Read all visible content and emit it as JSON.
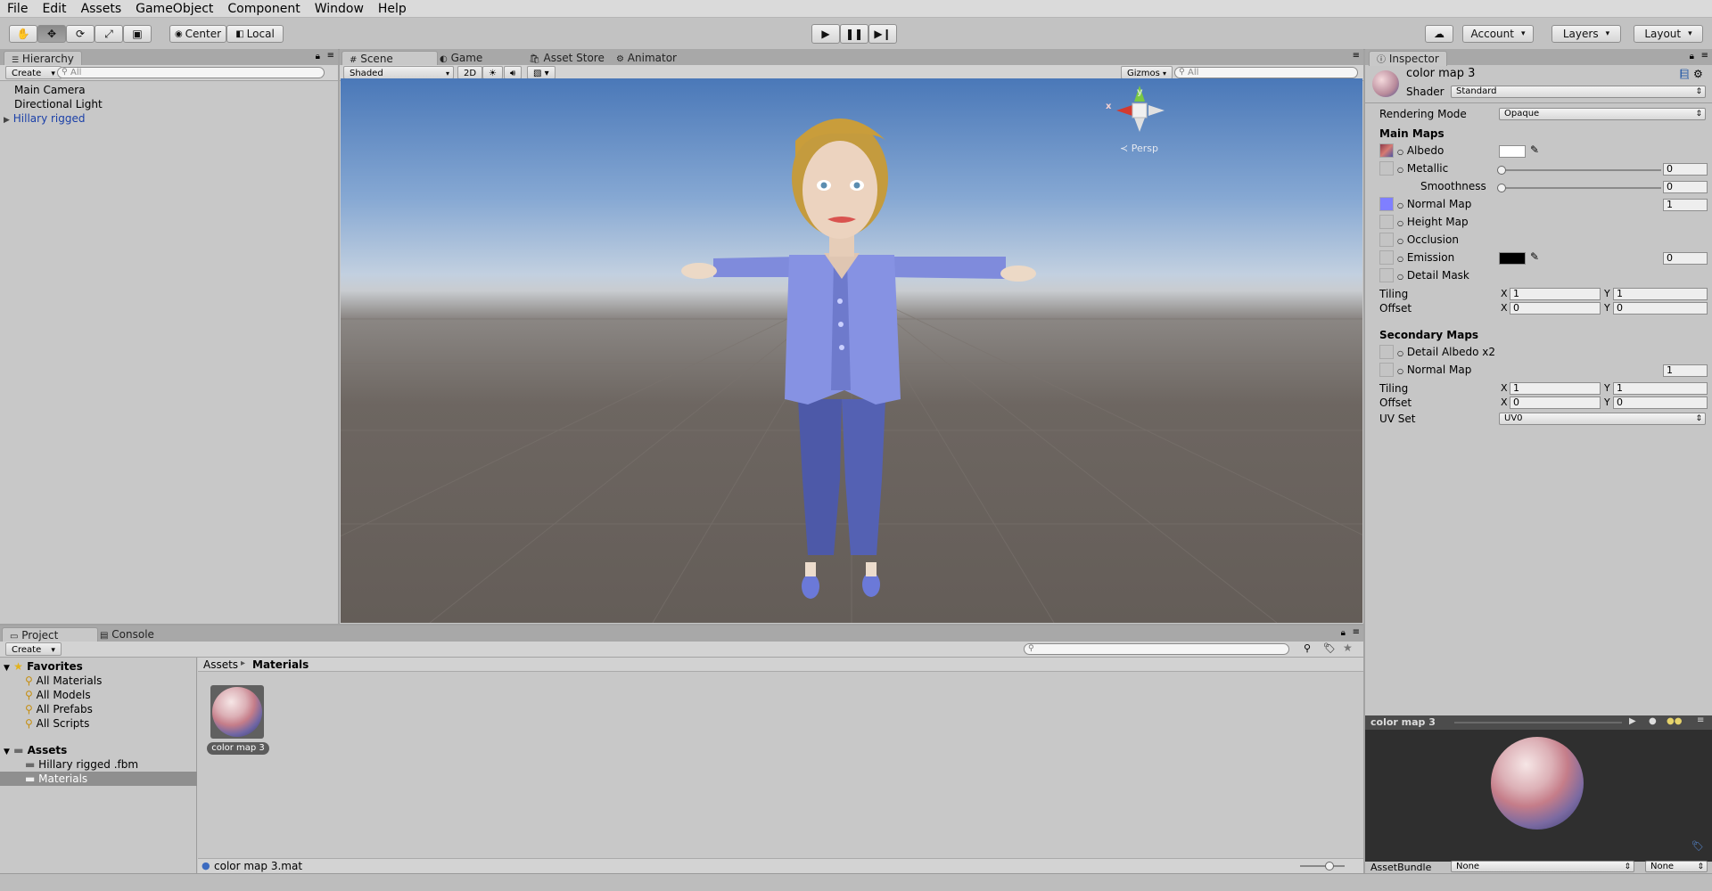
{
  "menubar": {
    "items": [
      "File",
      "Edit",
      "Assets",
      "GameObject",
      "Component",
      "Window",
      "Help"
    ]
  },
  "toolbar": {
    "tools": [
      "hand-tool",
      "move-tool",
      "rotate-tool",
      "scale-tool",
      "rect-tool"
    ],
    "pivot_label": "Center",
    "space_label": "Local",
    "account_label": "Account",
    "layers_label": "Layers",
    "layout_label": "Layout"
  },
  "hierarchy": {
    "tab": "Hierarchy",
    "create_label": "Create",
    "search_placeholder": "All",
    "items": [
      "Main Camera",
      "Directional Light",
      "Hillary rigged"
    ]
  },
  "scene": {
    "tabs": [
      "Scene",
      "Game",
      "Asset Store",
      "Animator"
    ],
    "shading": "Shaded",
    "mode_2d": "2D",
    "gizmos_label": "Gizmos",
    "search_placeholder": "All",
    "persp_label": "Persp",
    "gizmo_axes": [
      "y",
      "x"
    ]
  },
  "inspector": {
    "tab": "Inspector",
    "material_name": "color map 3",
    "shader_label": "Shader",
    "shader_value": "Standard",
    "rendering_mode_label": "Rendering Mode",
    "rendering_mode_value": "Opaque",
    "main_maps_title": "Main Maps",
    "albedo_label": "Albedo",
    "metallic_label": "Metallic",
    "metallic_value": "0",
    "smoothness_label": "Smoothness",
    "smoothness_value": "0",
    "normal_map_label": "Normal Map",
    "normal_map_value": "1",
    "height_map_label": "Height Map",
    "occlusion_label": "Occlusion",
    "emission_label": "Emission",
    "emission_value": "0",
    "detail_mask_label": "Detail Mask",
    "tiling_label": "Tiling",
    "offset_label": "Offset",
    "x_label": "X",
    "y_label": "Y",
    "main_tiling": [
      "1",
      "1"
    ],
    "main_offset": [
      "0",
      "0"
    ],
    "secondary_maps_title": "Secondary Maps",
    "detail_albedo_label": "Detail Albedo x2",
    "sec_normal_map_label": "Normal Map",
    "sec_normal_value": "1",
    "sec_tiling": [
      "1",
      "1"
    ],
    "sec_offset": [
      "0",
      "0"
    ],
    "uv_set_label": "UV Set",
    "uv_set_value": "UV0",
    "preview_title": "color map 3",
    "assetbundle_label": "AssetBundle",
    "assetbundle_value": "None",
    "assetbundle_variant": "None",
    "colors": {
      "albedo": "#ffffff",
      "emission": "#000000",
      "normal_slot": "#7f7fff"
    }
  },
  "project": {
    "tabs": [
      "Project",
      "Console"
    ],
    "create_label": "Create",
    "favorites_label": "Favorites",
    "favorites": [
      "All Materials",
      "All Models",
      "All Prefabs",
      "All Scripts"
    ],
    "assets_label": "Assets",
    "assets": [
      "Hillary rigged .fbm",
      "Materials"
    ],
    "breadcrumb": [
      "Assets",
      "Materials"
    ],
    "asset_item": "color map 3",
    "footer_file": "color map 3.mat"
  }
}
